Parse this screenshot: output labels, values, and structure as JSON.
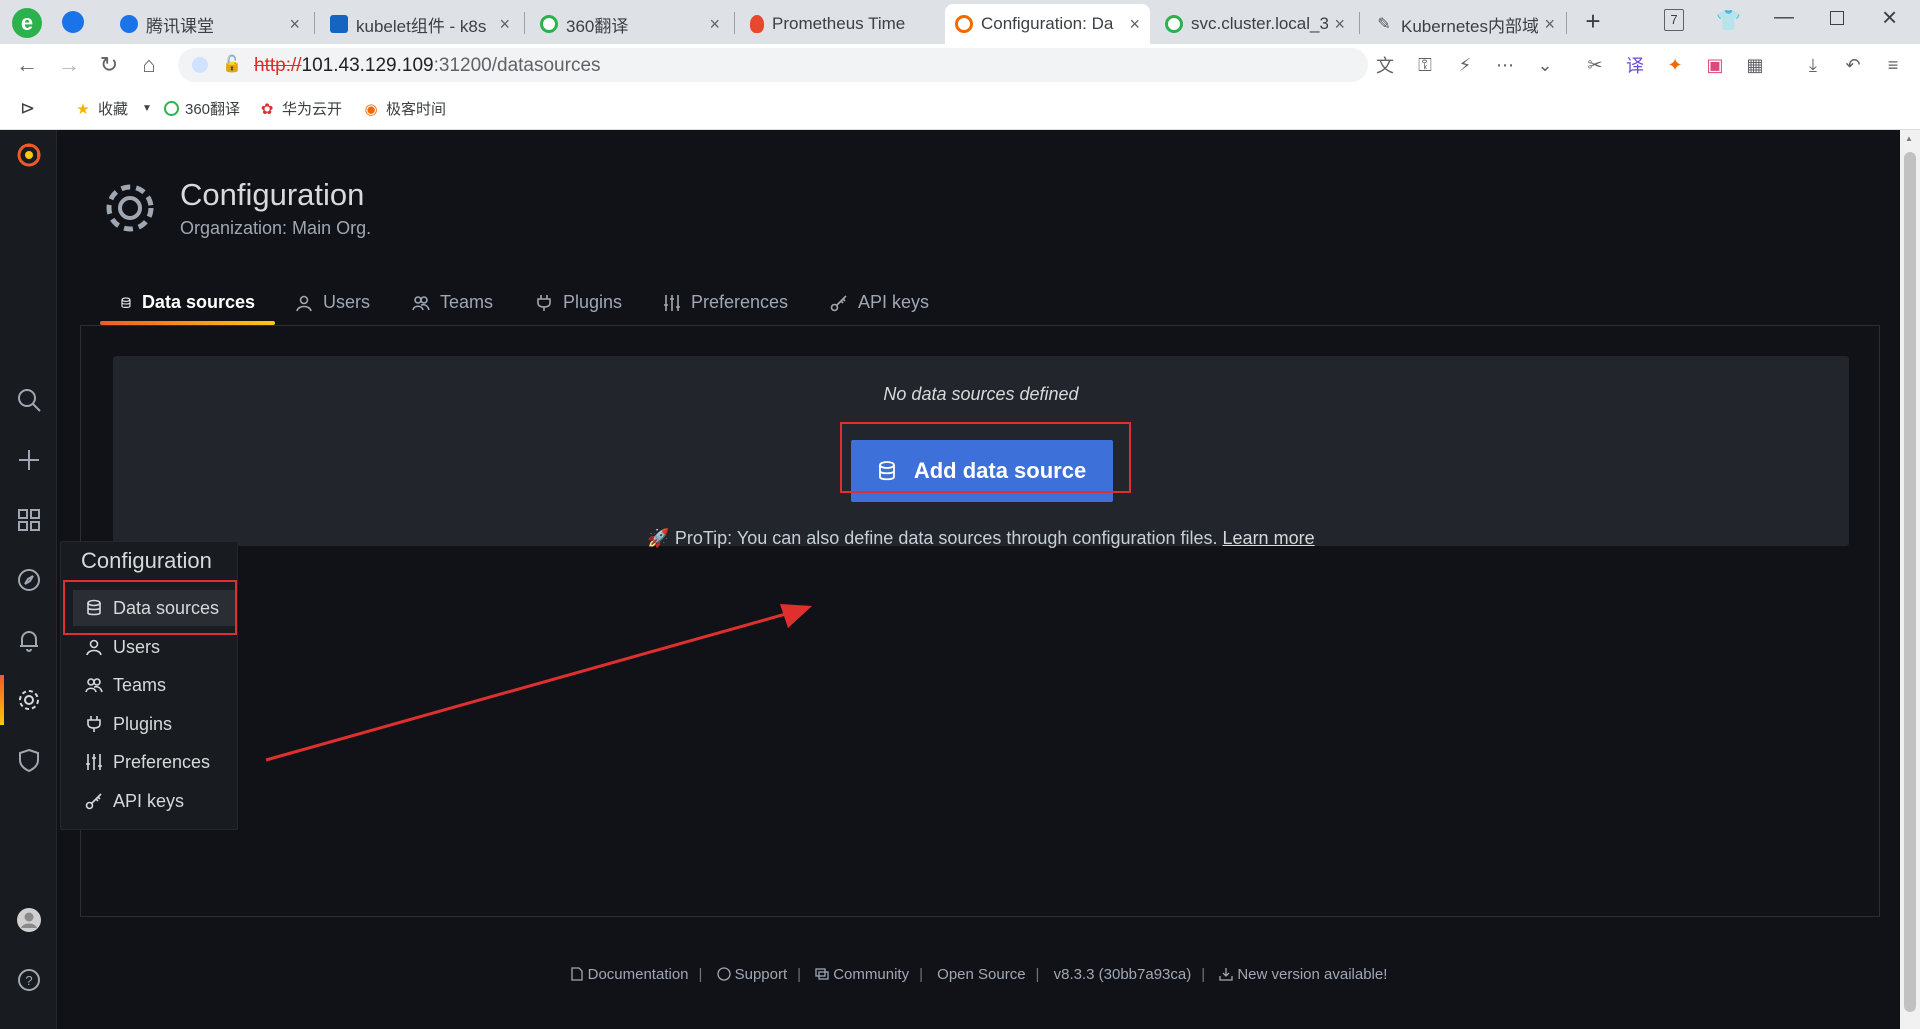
{
  "browser": {
    "tabs": [
      {
        "title": "腾讯课堂",
        "color": "#1a73e8",
        "active": false
      },
      {
        "title": "kubelet组件 - k8s",
        "color": "#1565c0",
        "active": false
      },
      {
        "title": "360翻译",
        "color": "#2bb24c",
        "active": false
      },
      {
        "title": "Prometheus Time",
        "color": "#e8472b",
        "active": false
      },
      {
        "title": "Configuration: Da",
        "color": "#f46800",
        "active": true
      },
      {
        "title": "svc.cluster.local_3",
        "color": "#2bb24c",
        "active": false
      },
      {
        "title": "Kubernetes内部域",
        "color": "#555555",
        "active": false
      }
    ],
    "tab_counter": "7",
    "url_scheme": "http://",
    "url_host": "101.43.129.109",
    "url_rest": ":31200/datasources",
    "bookmarks": [
      "收藏",
      "360翻译",
      "华为云开",
      "极客时间"
    ]
  },
  "page": {
    "title": "Configuration",
    "subtitle": "Organization: Main Org.",
    "tabs": [
      "Data sources",
      "Users",
      "Teams",
      "Plugins",
      "Preferences",
      "API keys"
    ],
    "empty_title": "No data sources defined",
    "add_button": "Add data source",
    "protip": "ProTip: You can also define data sources through configuration files.",
    "learn_more": "Learn more"
  },
  "flyout": {
    "title": "Configuration",
    "items": [
      "Data sources",
      "Users",
      "Teams",
      "Plugins",
      "Preferences",
      "API keys"
    ]
  },
  "footer": {
    "documentation": "Documentation",
    "support": "Support",
    "community": "Community",
    "open_source": "Open Source",
    "version": "v8.3.3 (30bb7a93ca)",
    "new_version": "New version available!"
  },
  "colors": {
    "accent": "#3d71d9",
    "highlight": "#e02f2f",
    "grafana_orange": "#f05a28"
  }
}
